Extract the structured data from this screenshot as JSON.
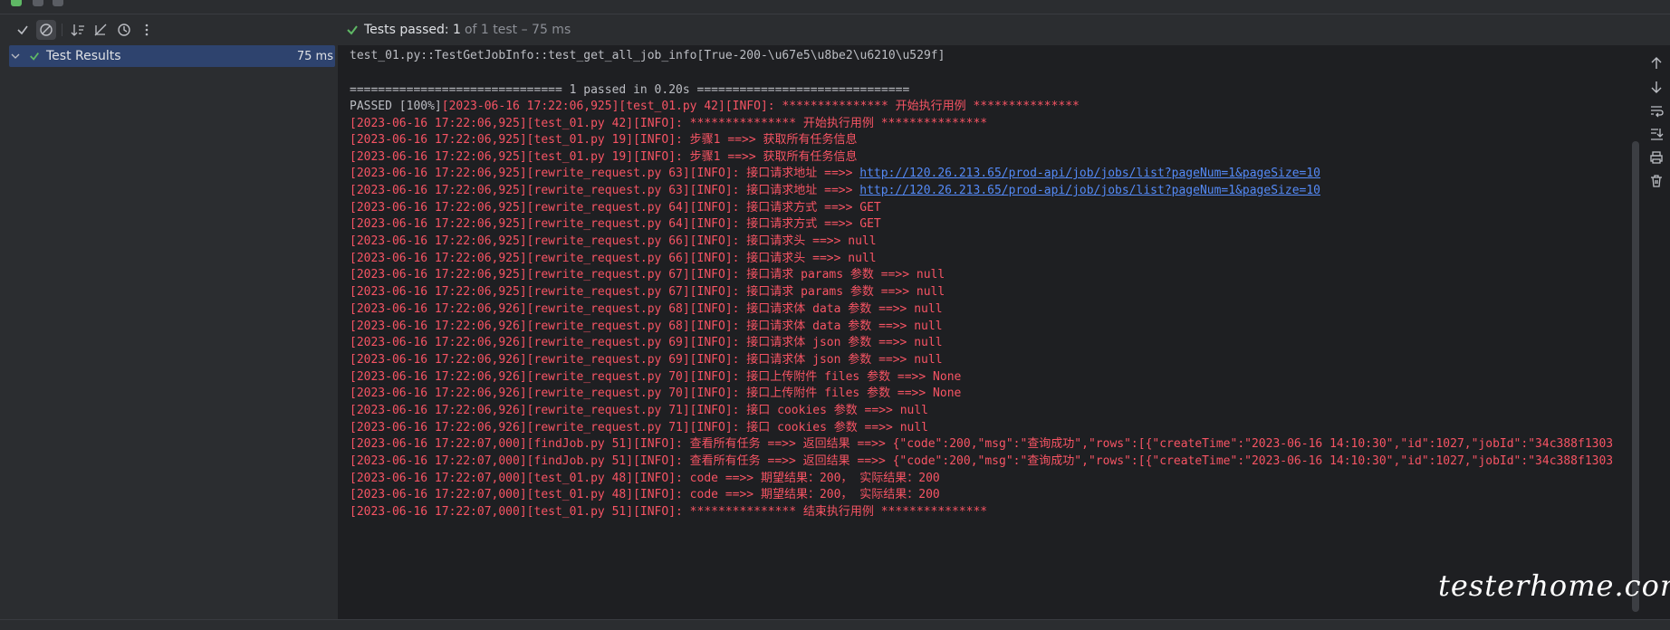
{
  "status": {
    "passed_label": "Tests passed: 1",
    "extra": "of 1 test – 75 ms"
  },
  "tree": {
    "root_label": "Test Results",
    "root_duration": "75 ms"
  },
  "console": {
    "header": "test_01.py::TestGetJobInfo::test_get_all_job_info[True-200-\\u67e5\\u8be2\\u6210\\u529f]",
    "summary": "============================== 1 passed in 0.20s ==============================",
    "passed_prefix": "PASSED [100%]",
    "lines": [
      "[2023-06-16 17:22:06,925][test_01.py 42][INFO]: *************** 开始执行用例 ***************",
      "[2023-06-16 17:22:06,925][test_01.py 42][INFO]: *************** 开始执行用例 ***************",
      "[2023-06-16 17:22:06,925][test_01.py 19][INFO]: 步骤1 ==>> 获取所有任务信息",
      "[2023-06-16 17:22:06,925][test_01.py 19][INFO]: 步骤1 ==>> 获取所有任务信息",
      "[2023-06-16 17:22:06,925][rewrite_request.py 63][INFO]: 接口请求地址 ==>> ",
      "[2023-06-16 17:22:06,925][rewrite_request.py 63][INFO]: 接口请求地址 ==>> ",
      "[2023-06-16 17:22:06,925][rewrite_request.py 64][INFO]: 接口请求方式 ==>> GET",
      "[2023-06-16 17:22:06,925][rewrite_request.py 64][INFO]: 接口请求方式 ==>> GET",
      "[2023-06-16 17:22:06,925][rewrite_request.py 66][INFO]: 接口请求头 ==>> null",
      "[2023-06-16 17:22:06,925][rewrite_request.py 66][INFO]: 接口请求头 ==>> null",
      "[2023-06-16 17:22:06,925][rewrite_request.py 67][INFO]: 接口请求 params 参数 ==>> null",
      "[2023-06-16 17:22:06,925][rewrite_request.py 67][INFO]: 接口请求 params 参数 ==>> null",
      "[2023-06-16 17:22:06,926][rewrite_request.py 68][INFO]: 接口请求体 data 参数 ==>> null",
      "[2023-06-16 17:22:06,926][rewrite_request.py 68][INFO]: 接口请求体 data 参数 ==>> null",
      "[2023-06-16 17:22:06,926][rewrite_request.py 69][INFO]: 接口请求体 json 参数 ==>> null",
      "[2023-06-16 17:22:06,926][rewrite_request.py 69][INFO]: 接口请求体 json 参数 ==>> null",
      "[2023-06-16 17:22:06,926][rewrite_request.py 70][INFO]: 接口上传附件 files 参数 ==>> None",
      "[2023-06-16 17:22:06,926][rewrite_request.py 70][INFO]: 接口上传附件 files 参数 ==>> None",
      "[2023-06-16 17:22:06,926][rewrite_request.py 71][INFO]: 接口 cookies 参数 ==>> null",
      "[2023-06-16 17:22:06,926][rewrite_request.py 71][INFO]: 接口 cookies 参数 ==>> null",
      "[2023-06-16 17:22:07,000][findJob.py 51][INFO]: 查看所有任务 ==>> 返回结果 ==>> {\"code\":200,\"msg\":\"查询成功\",\"rows\":[{\"createTime\":\"2023-06-16 14:10:30\",\"id\":1027,\"jobId\":\"34c388f1303",
      "[2023-06-16 17:22:07,000][findJob.py 51][INFO]: 查看所有任务 ==>> 返回结果 ==>> {\"code\":200,\"msg\":\"查询成功\",\"rows\":[{\"createTime\":\"2023-06-16 14:10:30\",\"id\":1027,\"jobId\":\"34c388f1303",
      "[2023-06-16 17:22:07,000][test_01.py 48][INFO]: code ==>> 期望结果：200， 实际结果：200",
      "[2023-06-16 17:22:07,000][test_01.py 48][INFO]: code ==>> 期望结果：200， 实际结果：200",
      "[2023-06-16 17:22:07,000][test_01.py 51][INFO]: *************** 结束执行用例 ***************"
    ],
    "request_url": "http://120.26.213.65/prod-api/job/jobs/list?pageNum=1&pageSize=10"
  },
  "watermark": "testerhome.com",
  "colors": {
    "pass_green": "#5fb865",
    "log_red": "#f75464",
    "link_blue": "#548af7",
    "selection": "#2e436e"
  },
  "icons": {
    "left_toolbar": [
      "checkmark-icon",
      "block-icon",
      "sort-icon",
      "collapse-icon",
      "history-icon",
      "more-icon"
    ],
    "right_toolbar": [
      "arrow-up-icon",
      "arrow-down-icon",
      "soft-wrap-icon",
      "scroll-to-end-icon",
      "print-icon",
      "trash-icon"
    ]
  }
}
